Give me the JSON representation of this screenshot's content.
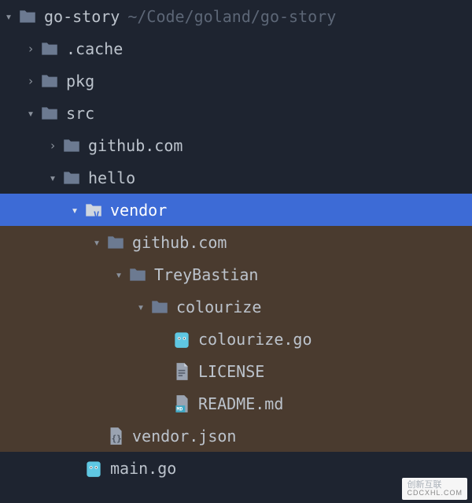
{
  "project": {
    "name": "go-story",
    "path": "~/Code/goland/go-story"
  },
  "tree": {
    "cache": ".cache",
    "pkg": "pkg",
    "src": "src",
    "github_src": "github.com",
    "hello": "hello",
    "vendor": "vendor",
    "github_vendor": "github.com",
    "trey": "TreyBastian",
    "colourize": "colourize",
    "colourize_go": "colourize.go",
    "license": "LICENSE",
    "readme": "README.md",
    "vendor_json": "vendor.json",
    "main_go": "main.go"
  },
  "icons": {
    "folder": "folder-icon",
    "folder_v": "folder-vendor-icon",
    "go_file": "go-file-icon",
    "text_file": "text-file-icon",
    "md_file": "markdown-file-icon",
    "json_file": "json-file-icon"
  },
  "watermark": {
    "brand": "创新互联",
    "sub": "CDCXHL.COM"
  }
}
